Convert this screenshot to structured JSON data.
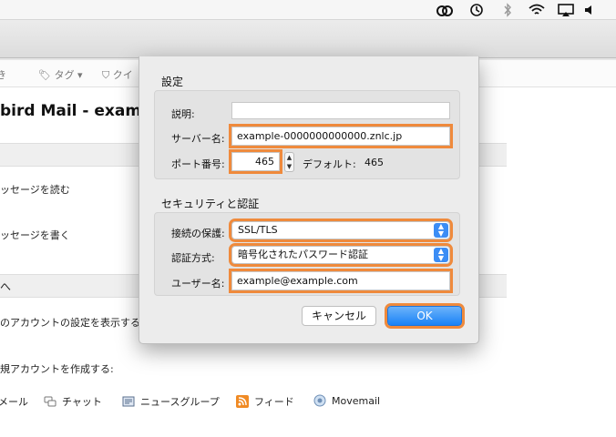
{
  "background": {
    "filter_tag": "タグ",
    "filter_quick": "クイ",
    "account_title": "bird Mail - example@",
    "read_messages": "ッセージを読む",
    "write_messages": "ッセージを書く",
    "accounts_section": "へ",
    "view_account_settings": "のアカウントの設定を表示する",
    "create_account": "規アカウントを作成する:",
    "links": {
      "mail": "メール",
      "chat": "チャット",
      "newsgroup": "ニュースグループ",
      "feed": "フィード",
      "movemail": "Movemail"
    }
  },
  "dialog": {
    "settings_title": "設定",
    "description_label": "説明:",
    "description_value": "",
    "server_label": "サーバー名:",
    "server_value": "example-0000000000000.znlc.jp",
    "port_label": "ポート番号:",
    "port_value": "465",
    "default_label": "デフォルト:",
    "default_value": "465",
    "security_title": "セキュリティと認証",
    "connection_label": "接続の保護:",
    "connection_value": "SSL/TLS",
    "auth_label": "認証方式:",
    "auth_value": "暗号化されたパスワード認証",
    "username_label": "ユーザー名:",
    "username_value": "example@example.com",
    "cancel_label": "キャンセル",
    "ok_label": "OK"
  },
  "colors": {
    "highlight": "#ef8a3c",
    "ok_button": "#1a82f6",
    "select_arrow": "#3b8df5"
  }
}
